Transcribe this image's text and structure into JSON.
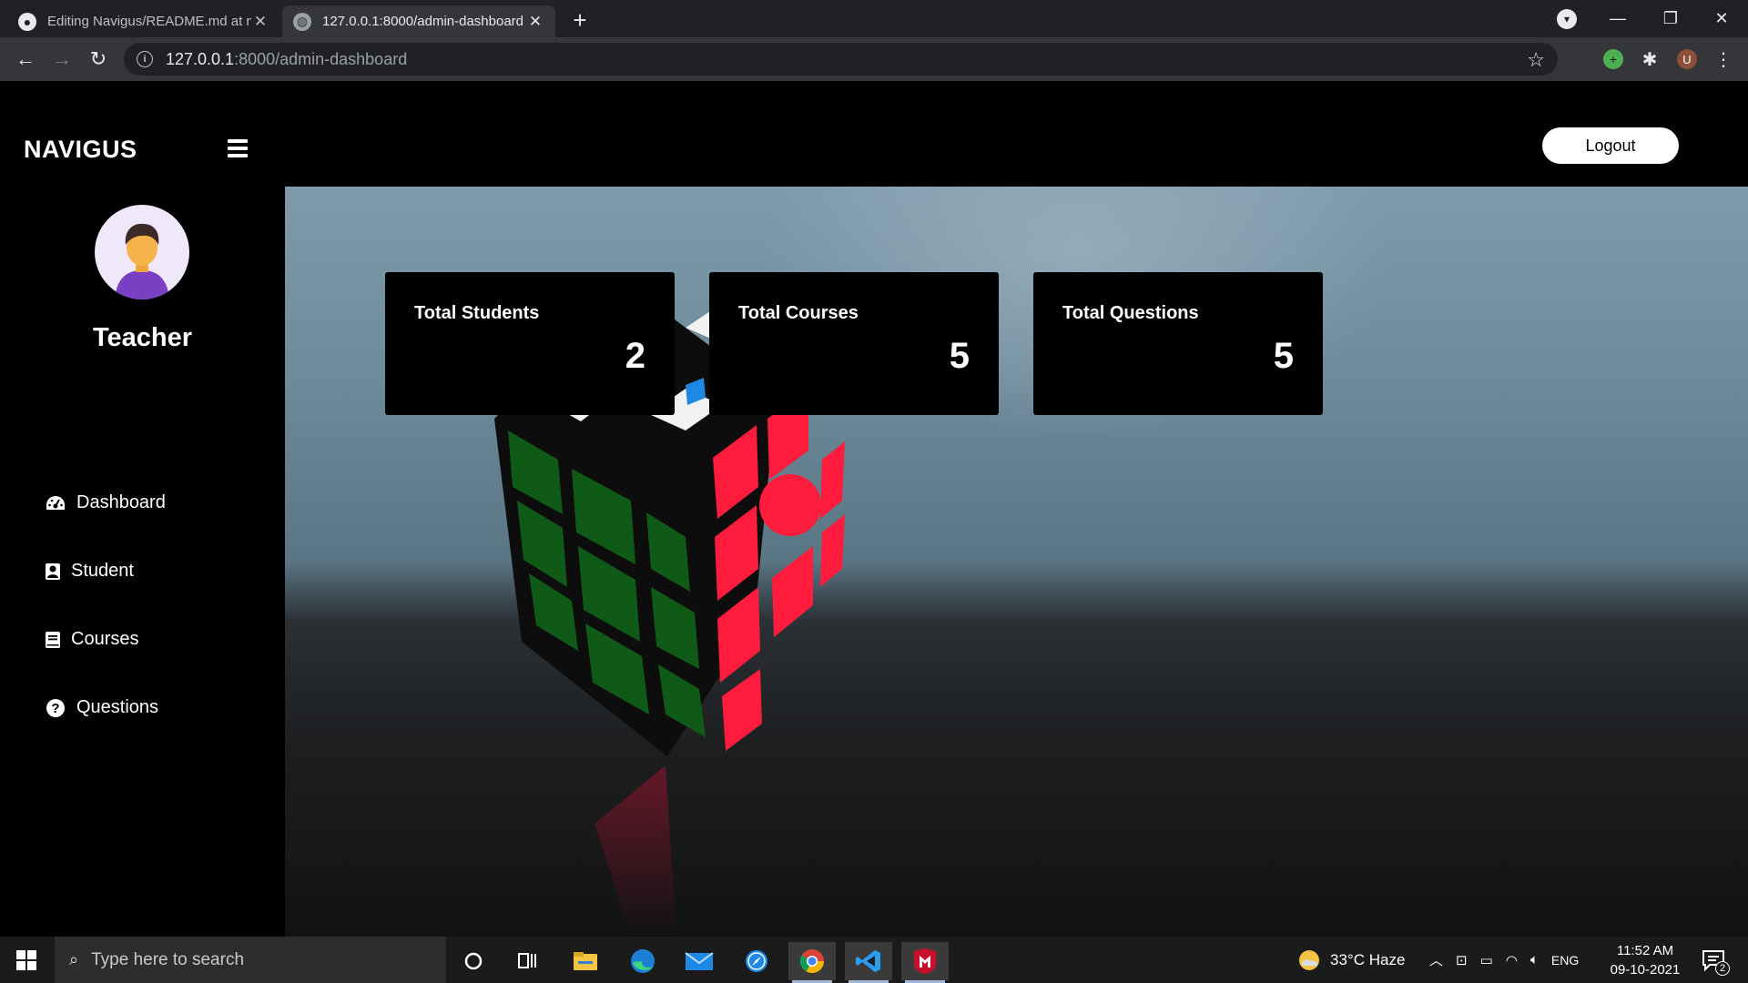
{
  "browser": {
    "tabs": [
      {
        "title": "Editing Navigus/README.md at master",
        "active": false
      },
      {
        "title": "127.0.0.1:8000/admin-dashboard",
        "active": true
      }
    ],
    "address": {
      "host": "127.0.0.1",
      "path": ":8000/admin-dashboard"
    },
    "profile_initial": "U"
  },
  "app": {
    "brand": "NAVIGUS",
    "logout_label": "Logout",
    "user_role": "Teacher",
    "sidebar": [
      {
        "label": "Dashboard",
        "icon": "gauge-icon"
      },
      {
        "label": "Student",
        "icon": "student-icon"
      },
      {
        "label": "Courses",
        "icon": "book-icon"
      },
      {
        "label": "Questions",
        "icon": "question-circle-icon"
      }
    ],
    "cards": [
      {
        "label": "Total Students",
        "value": "2"
      },
      {
        "label": "Total Courses",
        "value": "5"
      },
      {
        "label": "Total Questions",
        "value": "5"
      }
    ]
  },
  "taskbar": {
    "search_placeholder": "Type here to search",
    "weather": "33°C  Haze",
    "language": "ENG",
    "time": "11:52 AM",
    "date": "09-10-2021",
    "notifications": "2"
  },
  "colors": {
    "page_bg": "#000000",
    "card_bg": "#000000",
    "logout_bg": "#ffffff",
    "tab_active": "#35363a"
  }
}
